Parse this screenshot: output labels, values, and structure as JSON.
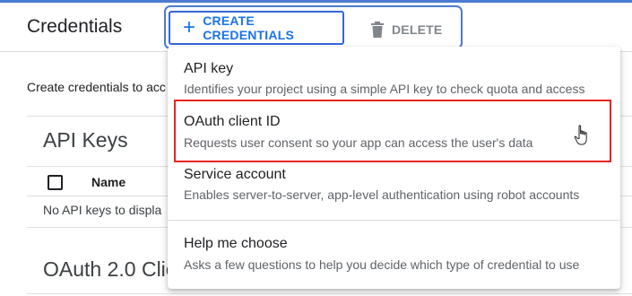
{
  "header": {
    "title": "Credentials",
    "create_button": "CREATE CREDENTIALS",
    "create_icon": "plus-icon",
    "delete_button": "DELETE",
    "delete_icon": "trash-icon"
  },
  "intro_text": "Create credentials to acc",
  "api_keys": {
    "title": "API Keys",
    "column_name": "Name",
    "empty_text": "No API keys to displa"
  },
  "oauth": {
    "title": "OAuth 2.0 Clie"
  },
  "dropdown": {
    "items": [
      {
        "title": "API key",
        "description": "Identifies your project using a simple API key to check quota and access"
      },
      {
        "title": "OAuth client ID",
        "description": "Requests user consent so your app can access the user's data"
      },
      {
        "title": "Service account",
        "description": "Enables server-to-server, app-level authentication using robot accounts"
      },
      {
        "title": "Help me choose",
        "description": "Asks a few questions to help you decide which type of credential to use"
      }
    ]
  },
  "colors": {
    "accent": "#1a73e8",
    "highlight": "#e8231f"
  }
}
